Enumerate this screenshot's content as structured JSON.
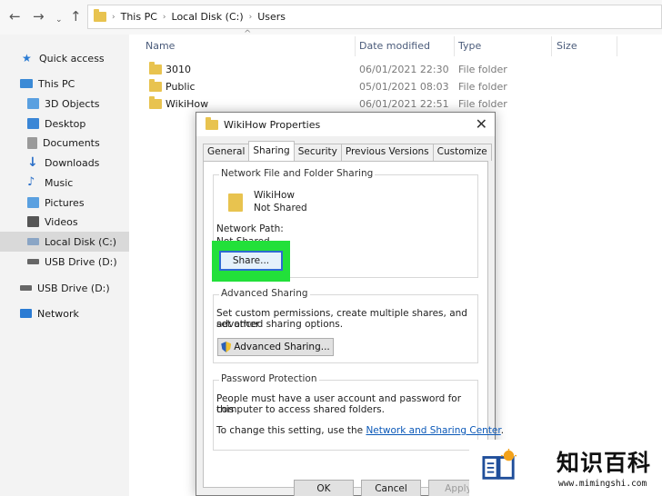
{
  "addressbar": {
    "crumbs": [
      "This PC",
      "Local Disk (C:)",
      "Users"
    ]
  },
  "sidebar": {
    "items": [
      {
        "label": "Quick access",
        "color": "#2a7bd3"
      },
      {
        "label": "This PC",
        "color": "#3b8ad6"
      },
      {
        "label": "3D Objects",
        "color": "#5aa0e0"
      },
      {
        "label": "Desktop",
        "color": "#3a86d6"
      },
      {
        "label": "Documents",
        "color": "#8c8c8c"
      },
      {
        "label": "Downloads",
        "color": "#2a6fc8"
      },
      {
        "label": "Music",
        "color": "#2a6fc8"
      },
      {
        "label": "Pictures",
        "color": "#5aa0e0"
      },
      {
        "label": "Videos",
        "color": "#555555"
      },
      {
        "label": "Local Disk (C:)",
        "color": "#8aa5c5"
      },
      {
        "label": "USB Drive (D:)",
        "color": "#666666"
      },
      {
        "label": "USB Drive (D:)",
        "color": "#666666"
      },
      {
        "label": "Network",
        "color": "#2a7bd3"
      }
    ]
  },
  "filelist": {
    "headers": {
      "name": "Name",
      "date": "Date modified",
      "type": "Type",
      "size": "Size"
    },
    "rows": [
      {
        "name": "3010",
        "date": "06/01/2021 22:30",
        "type": "File folder"
      },
      {
        "name": "Public",
        "date": "05/01/2021 08:03",
        "type": "File folder"
      },
      {
        "name": "WikiHow",
        "date": "06/01/2021 22:51",
        "type": "File folder"
      }
    ]
  },
  "dialog": {
    "title": "WikiHow Properties",
    "tabs": [
      "General",
      "Sharing",
      "Security",
      "Previous Versions",
      "Customize"
    ],
    "network_sharing": {
      "title": "Network File and Folder Sharing",
      "folder_name": "WikiHow",
      "status": "Not Shared",
      "path_label": "Network Path:",
      "path_value": "Not Shared",
      "share_button": "Share..."
    },
    "advanced": {
      "title": "Advanced Sharing",
      "line1": "Set custom permissions, create multiple shares, and set other",
      "line2": "advanced sharing options.",
      "button": "Advanced Sharing..."
    },
    "password": {
      "title": "Password Protection",
      "line1": "People must have a user account and password for this",
      "line2": "computer to access shared folders.",
      "line3": "To change this setting, use the",
      "link": "Network and Sharing Center",
      "line3_end": "."
    },
    "buttons": {
      "ok": "OK",
      "cancel": "Cancel",
      "apply": "Apply"
    }
  },
  "watermark": {
    "title": "知识百科",
    "url": "www.mimingshi.com"
  }
}
